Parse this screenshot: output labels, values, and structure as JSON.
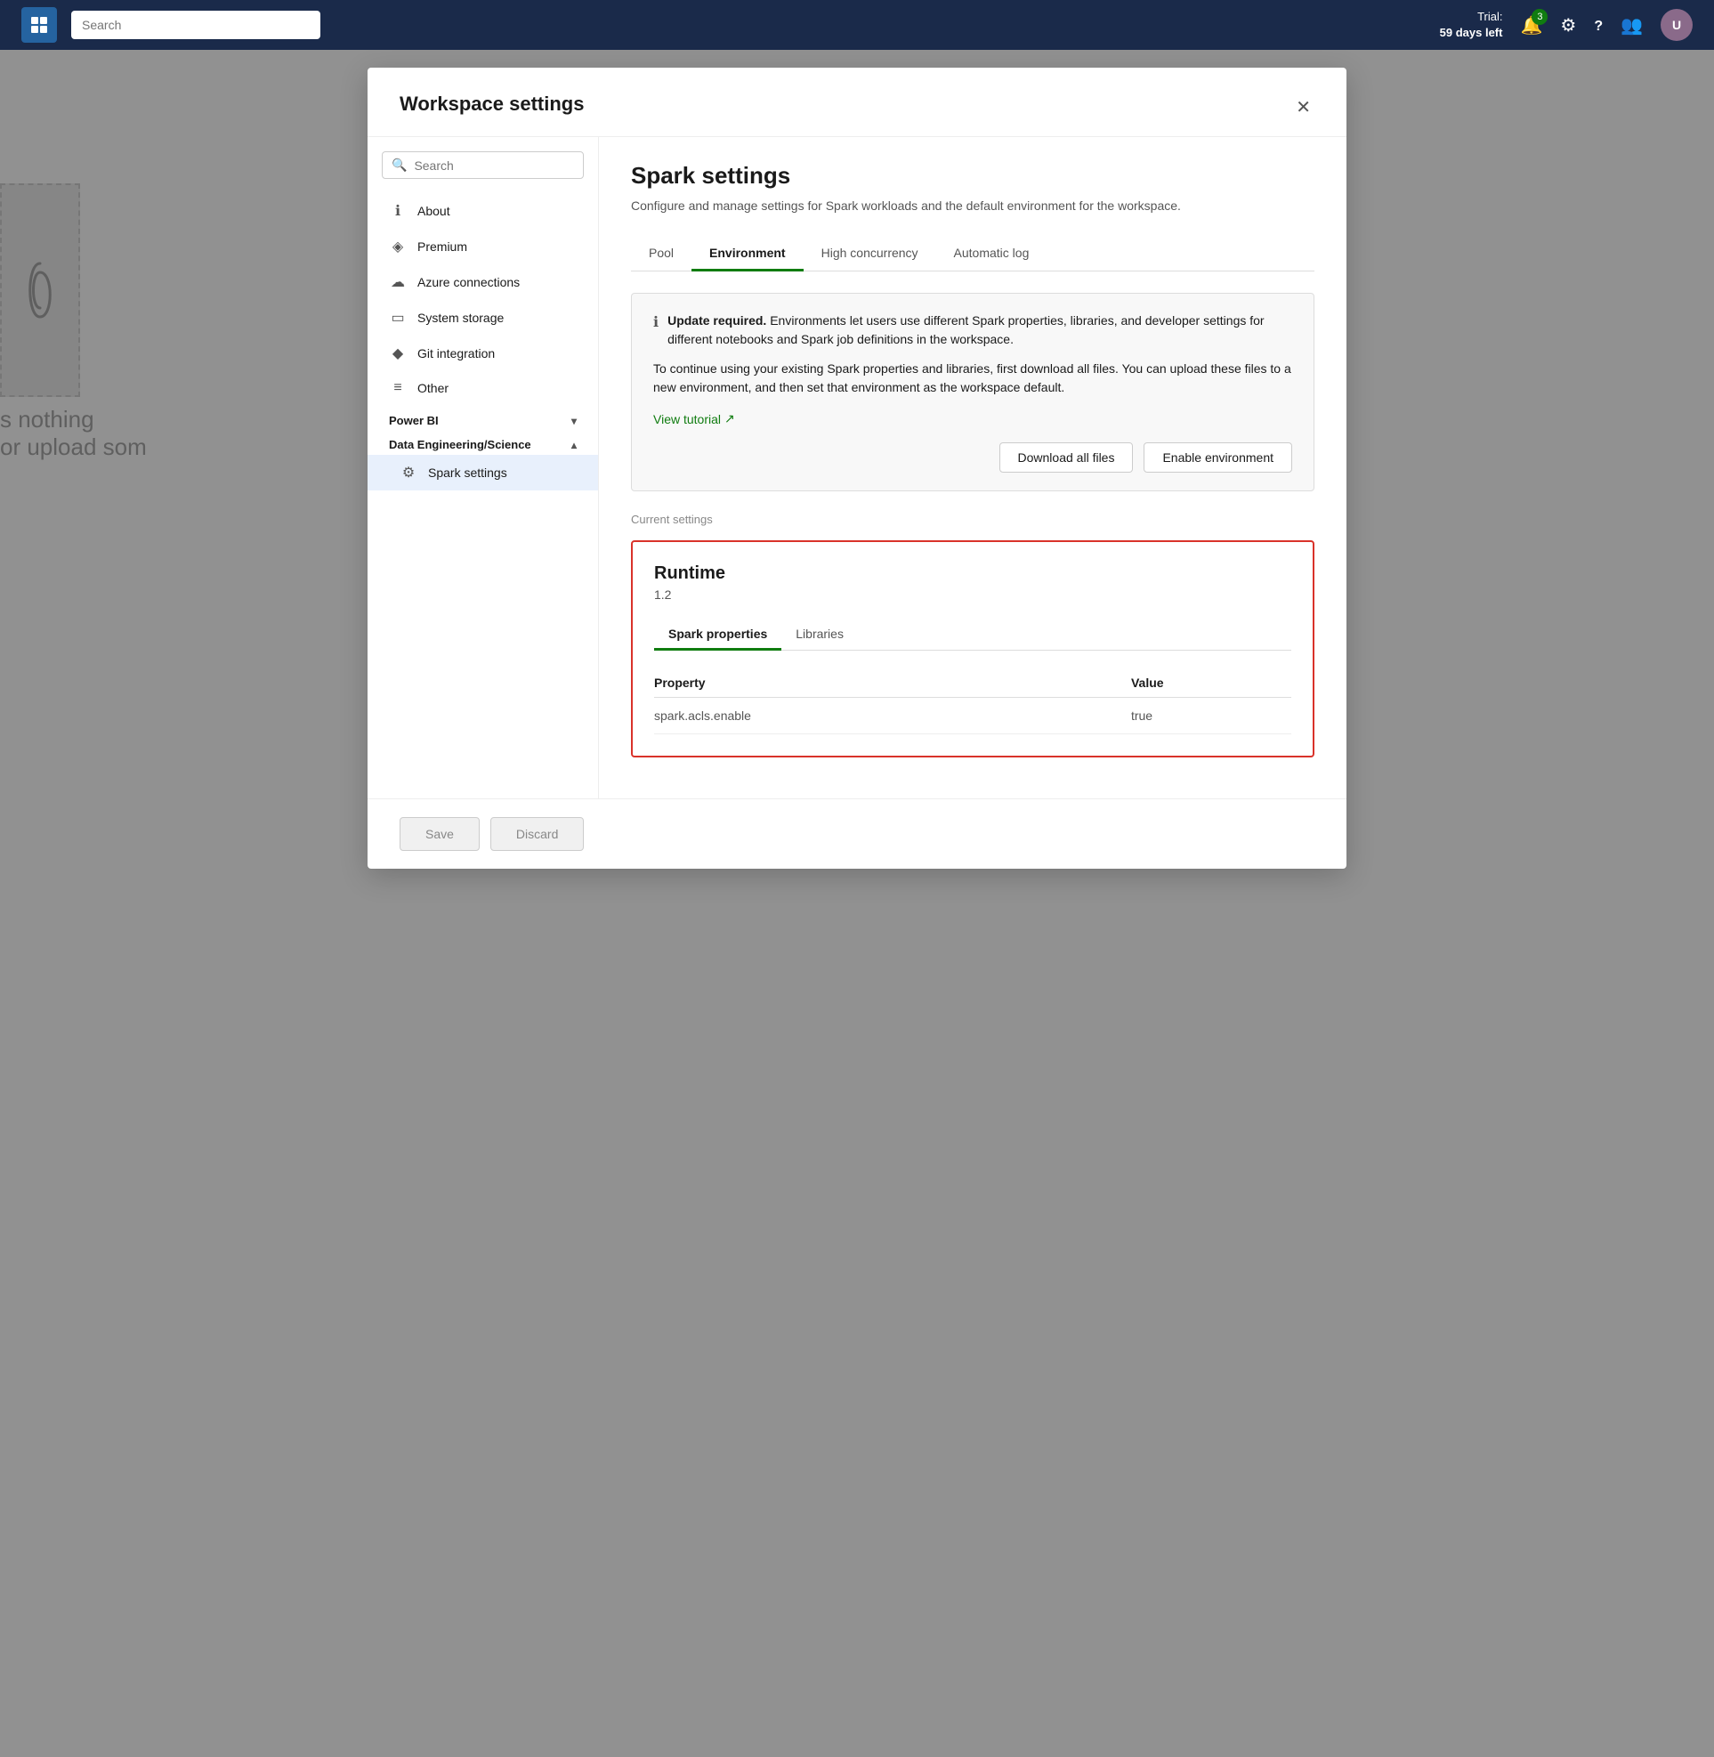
{
  "topbar": {
    "search_placeholder": "Search",
    "trial_line1": "Trial:",
    "trial_line2": "59 days left",
    "notification_count": "3",
    "icons": {
      "bell": "🔔",
      "gear": "⚙",
      "question": "?",
      "people": "👥"
    }
  },
  "bg": {
    "nothing_text1": "s nothing",
    "nothing_text2": "or upload som"
  },
  "modal": {
    "title": "Workspace settings",
    "close_label": "✕",
    "search_placeholder": "Search",
    "nav_items": [
      {
        "id": "about",
        "label": "About",
        "icon": "ℹ"
      },
      {
        "id": "premium",
        "label": "Premium",
        "icon": "◈"
      },
      {
        "id": "azure",
        "label": "Azure connections",
        "icon": "☁"
      },
      {
        "id": "storage",
        "label": "System storage",
        "icon": "▭"
      },
      {
        "id": "git",
        "label": "Git integration",
        "icon": "◆"
      },
      {
        "id": "other",
        "label": "Other",
        "icon": "≡"
      }
    ],
    "sections": [
      {
        "id": "powerbi",
        "label": "Power BI",
        "expanded": false
      },
      {
        "id": "dataeng",
        "label": "Data Engineering/Science",
        "expanded": true
      }
    ],
    "child_items": [
      {
        "id": "spark",
        "label": "Spark settings",
        "icon": "⚙",
        "active": true
      }
    ],
    "content": {
      "page_title": "Spark settings",
      "page_subtitle": "Configure and manage settings for Spark workloads and the default environment for the workspace.",
      "tabs": [
        {
          "id": "pool",
          "label": "Pool",
          "active": false
        },
        {
          "id": "environment",
          "label": "Environment",
          "active": true
        },
        {
          "id": "high_concurrency",
          "label": "High concurrency",
          "active": false
        },
        {
          "id": "automatic_log",
          "label": "Automatic log",
          "active": false
        }
      ],
      "alert": {
        "icon": "ℹ",
        "text_bold": "Update required.",
        "text_main": " Environments let users use different Spark properties, libraries, and developer settings for different notebooks and Spark job definitions in the workspace.",
        "text_secondary": "To continue using your existing Spark properties and libraries, first download all files. You can upload these files to a new environment, and then set that environment as the workspace default.",
        "tutorial_link": "View tutorial",
        "tutorial_icon": "↗",
        "btn_download": "Download all files",
        "btn_enable": "Enable environment"
      },
      "current_settings_label": "Current settings",
      "runtime": {
        "title": "Runtime",
        "version": "1.2",
        "inner_tabs": [
          {
            "id": "spark_props",
            "label": "Spark properties",
            "active": true
          },
          {
            "id": "libraries",
            "label": "Libraries",
            "active": false
          }
        ],
        "table": {
          "col_property": "Property",
          "col_value": "Value",
          "rows": [
            {
              "property": "spark.acls.enable",
              "value": "true"
            }
          ]
        }
      }
    },
    "footer": {
      "save_label": "Save",
      "discard_label": "Discard"
    }
  }
}
